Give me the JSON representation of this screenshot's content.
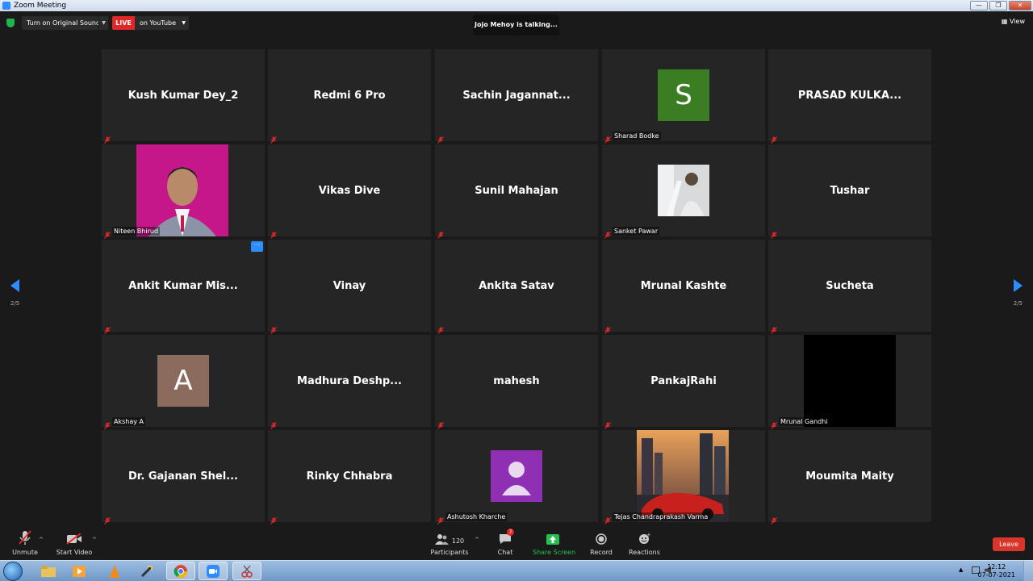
{
  "window": {
    "title": "Zoom Meeting",
    "min": "—",
    "max": "❐",
    "close": "✕"
  },
  "topbar": {
    "original_sound": "Turn on Original Sound",
    "live_badge": "LIVE",
    "youtube": "on YouTube",
    "talking": "Jojo Mehoy is talking...",
    "view": "View"
  },
  "pager": {
    "left": "2/5",
    "right": "2/5"
  },
  "tiles": [
    {
      "name": "Kush Kumar Dey_2"
    },
    {
      "name": "Redmi 6 Pro"
    },
    {
      "name": "Sachin  Jagannat..."
    },
    {
      "label": "Sharad Bodke",
      "avatar_letter": "S",
      "avatar_color": "#3a7d22"
    },
    {
      "name": "PRASAD  KULKA..."
    },
    {
      "label": "Niteen  Bhirud"
    },
    {
      "name": "Vikas Dive"
    },
    {
      "name": "Sunil Mahajan"
    },
    {
      "label": "Sanket Pawar"
    },
    {
      "name": "Tushar"
    },
    {
      "name": "Ankit  Kumar  Mis..."
    },
    {
      "name": "Vinay"
    },
    {
      "name": "Ankita Satav"
    },
    {
      "name": "Mrunal Kashte"
    },
    {
      "name": "Sucheta"
    },
    {
      "label": "Akshay A",
      "avatar_letter": "A",
      "avatar_color": "#8a6b5e"
    },
    {
      "name": "Madhura  Deshp..."
    },
    {
      "name": "mahesh"
    },
    {
      "name": "PankajRahi"
    },
    {
      "label": "Mrunal Gandhi"
    },
    {
      "name": "Dr. Gajanan  Shel..."
    },
    {
      "name": "Rinky Chhabra"
    },
    {
      "label": "Ashutosh Kharche",
      "avatar_color": "#8e2fb4"
    },
    {
      "label": "Tejas Chandraprakash Varma"
    },
    {
      "name": "Moumita Maity"
    }
  ],
  "toolbar": {
    "unmute": "Unmute",
    "start_video": "Start Video",
    "participants": "Participants",
    "participants_count": "120",
    "chat": "Chat",
    "chat_badge": "7",
    "share": "Share Screen",
    "record": "Record",
    "reactions": "Reactions",
    "leave": "Leave"
  },
  "taskbar": {
    "time": "12:12",
    "date": "07-07-2021"
  },
  "colors": {
    "accent": "#2d8cff",
    "share_green": "#25c04e",
    "live_red": "#e02828",
    "leave_red": "#d9362b"
  }
}
